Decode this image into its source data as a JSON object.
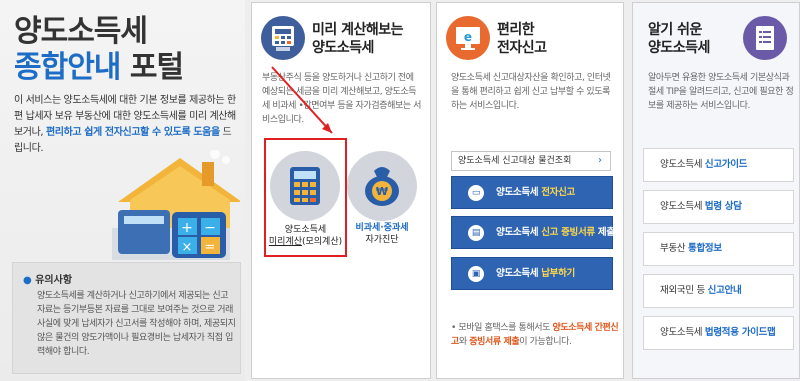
{
  "intro": {
    "title_line1": "양도소득세",
    "title_line2_blue": "종합안내",
    "title_line2_dark": "포털",
    "description": "이 서비스는 양도소득세에 대한 기본 정보를 제공하는 한편 납세자 보유 부동산에 대한 양도소득세를 미리 계산해 보거나, ",
    "description_highlight": "편리하고 쉽게 전자신고할 수 있도록 도움을",
    "description_end": " 드립니다.",
    "notice_title": "유의사항",
    "notice_body": "양도소득세를 계산하거나 신고하기에서 제공되는 신고 자료는 등기부등본 자료를 그대로 보여주는 것으로 거래 사실에 맞게 납세자가 신고서를 작성해야 하며, 제공되지 않은 물건의 양도가액이나 필요경비는 납세자가 직접 입력해야 합니다."
  },
  "calc_panel": {
    "title_line1": "미리 계산해보는",
    "title_line2": "양도소득세",
    "description": "부동산주식 등을 양도하거나 신고하기 전에 예상되는 세금을 미리 계산해보고, 양도소득세 비과세 •감면여부 등을 자가검증해보는 서비스입니다.",
    "calc_label_line1": "양도소득세",
    "calc_label_line2_u": "미리계산",
    "calc_label_line2_rest": "(모의계산)",
    "self_label_line1_blue": "비과세·중과세",
    "self_label_line2": "자가진단"
  },
  "efile_panel": {
    "title_line1": "편리한",
    "title_line2": "전자신고",
    "description": "양도소득세 신고대상자산을 확인하고, 인터넷을 통해 편리하고 쉽게 신고 납부할 수 있도록 하는 서비스입니다.",
    "select_label": "양도소득세 신고대상 물건조회",
    "buttons": [
      {
        "prefix": "양도소득세 ",
        "highlight": "전자신고",
        "suffix": ""
      },
      {
        "prefix": "양도소득세 ",
        "highlight": "신고 증빙서류",
        "suffix": " 제출"
      },
      {
        "prefix": "양도소득세 ",
        "highlight": "납부하기",
        "suffix": ""
      }
    ],
    "mobile_prefix": "• 모바일 홈택스를 통해서도 ",
    "mobile_highlight1": "양도소득세 간편신고",
    "mobile_mid": "와 ",
    "mobile_highlight2": "증빙서류 제출",
    "mobile_end": "이 가능합니다."
  },
  "guide_panel": {
    "title_line1": "알기 쉬운",
    "title_line2": "양도소득세",
    "description": "알아두면 유용한 양도소득세 기본상식과 절세 TIP을 알려드리고, 신고에 필요한 정보를 제공하는 서비스입니다.",
    "links": [
      {
        "prefix": "양도소득세 ",
        "highlight": "신고가이드"
      },
      {
        "prefix": "양도소득세 ",
        "highlight": "법령 상담"
      },
      {
        "prefix": "부동산 ",
        "highlight": "통합정보"
      },
      {
        "prefix": "재외국민 등 ",
        "highlight": "신고안내"
      },
      {
        "prefix": "양도소득세 ",
        "highlight": "법령적용 가이드맵"
      }
    ]
  },
  "icons": {
    "calc_panel": "calculator-screen-icon",
    "efile_panel": "monitor-e-icon",
    "guide_panel": "document-list-icon",
    "calculator": "calculator-icon",
    "self_check": "money-bag-won-icon",
    "select_chevron": "chevron-right-icon"
  },
  "colors": {
    "brand_blue": "#1d6cc6",
    "button_blue": "#2f64b3",
    "highlight_yellow": "#ffd84a",
    "highlight_orange": "#e0561a",
    "focus_red": "#e02020"
  }
}
